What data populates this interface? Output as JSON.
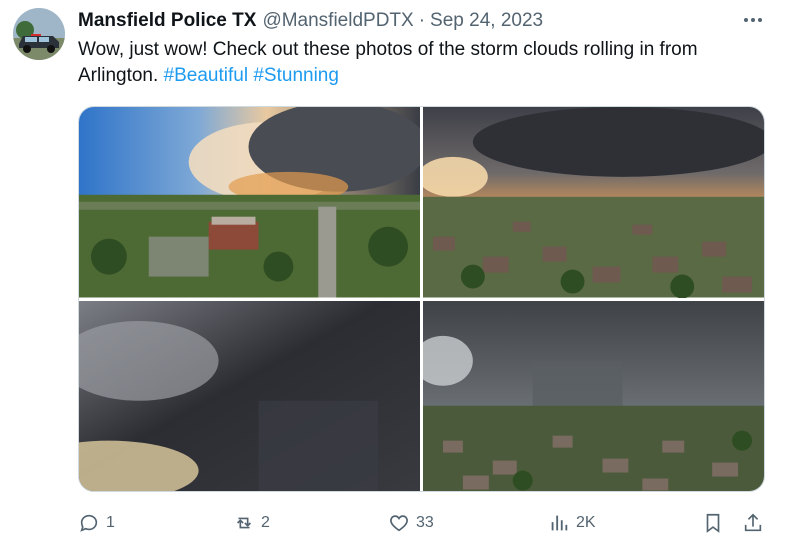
{
  "author": {
    "name": "Mansfield Police TX",
    "handle": "@MansfieldPDTX",
    "separator": "·",
    "date": "Sep 24, 2023",
    "avatar_icon": "police-suv-avatar"
  },
  "tweet": {
    "text_plain": "Wow, just wow! Check out these photos of the storm clouds rolling in from Arlington.",
    "hashtags": [
      "#Beautiful",
      "#Stunning"
    ]
  },
  "media": {
    "photos": [
      {
        "icon": "storm-over-building-photo"
      },
      {
        "icon": "storm-over-neighborhood-photo"
      },
      {
        "icon": "storm-cloud-closeup-photo"
      },
      {
        "icon": "rain-shaft-over-suburb-photo"
      }
    ]
  },
  "actions": {
    "reply_count": "1",
    "retweet_count": "2",
    "like_count": "33",
    "views_count": "2K"
  },
  "colors": {
    "text": "#0f1419",
    "secondary": "#536471",
    "link": "#1d9bf0",
    "border": "#cfd9de"
  }
}
